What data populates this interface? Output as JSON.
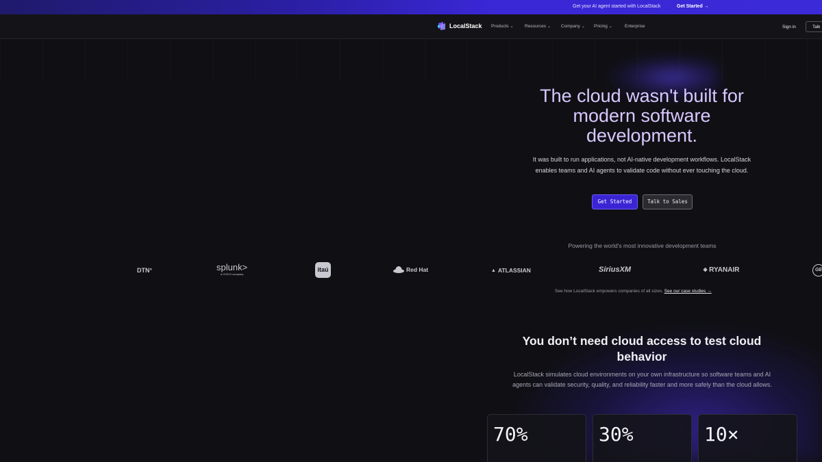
{
  "announcement": {
    "text": "Get your AI agent started with LocalStack",
    "cta": "Get Started →"
  },
  "nav": {
    "brand": "LocalStack",
    "items": [
      {
        "label": "Products",
        "has_menu": true
      },
      {
        "label": "Resources",
        "has_menu": true
      },
      {
        "label": "Company",
        "has_menu": true
      },
      {
        "label": "Pricing",
        "has_menu": true
      },
      {
        "label": "Enterprise",
        "has_menu": false
      }
    ],
    "sign_in": "Sign in",
    "talk": "Talk"
  },
  "hero": {
    "title": "The cloud wasn't built for modern software development.",
    "subtitle": "It was built to run applications, not AI-native development workflows. LocalStack enables teams and AI agents to validate code without ever touching the cloud.",
    "primary_cta": "Get Started",
    "secondary_cta": "Talk to Sales"
  },
  "logos": {
    "heading": "Powering the world's most innovative development teams",
    "companies": [
      "DTN°",
      "splunk>",
      "itaú",
      "Red Hat",
      "ATLASSIAN",
      "SiriusXM",
      "RYANAIR",
      "GE"
    ],
    "splunk_sub": "a CISCO company",
    "case_text": "See how LocalStack empowers companies of all sizes.",
    "case_link": "See our case studies →"
  },
  "section": {
    "title": "You don’t need cloud access to test cloud behavior",
    "subtitle": "LocalStack simulates cloud environments on your own infrastructure so software teams and AI agents can validate security, quality, and reliability faster and more safely than the cloud allows."
  },
  "stats": [
    {
      "value": "70%"
    },
    {
      "value": "30%"
    },
    {
      "value": "10×"
    }
  ],
  "colors": {
    "accent": "#3a24d4",
    "hero_title": "#d8c8ff",
    "background": "#101014"
  }
}
